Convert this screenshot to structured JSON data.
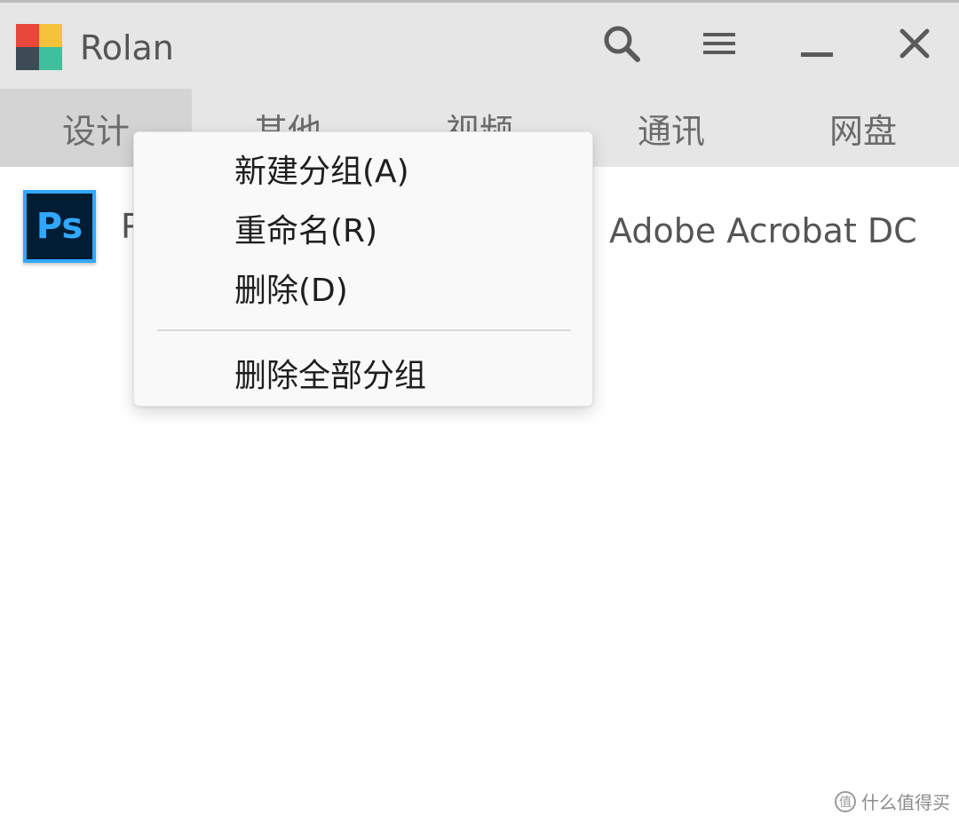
{
  "window": {
    "title": "Rolan",
    "logo_colors": [
      "#e8473c",
      "#f5c33b",
      "#3e4a56",
      "#3fbf9b"
    ]
  },
  "titlebar_buttons": {
    "search": "search-icon",
    "menu": "hamburger-menu-icon",
    "minimize": "minimize-icon",
    "close": "close-icon"
  },
  "tabs": [
    {
      "label": "设计",
      "active": true
    },
    {
      "label": "其他",
      "active": false
    },
    {
      "label": "视频",
      "active": false
    },
    {
      "label": "通讯",
      "active": false
    },
    {
      "label": "网盘",
      "active": false
    }
  ],
  "apps": [
    {
      "icon_text": "Ps",
      "label": "P",
      "icon_color": "#31a8ff",
      "icon_bg": "#001d34"
    },
    {
      "label": "Adobe Acrobat DC"
    }
  ],
  "context_menu": {
    "items": [
      {
        "label": "新建分组(A)"
      },
      {
        "label": "重命名(R)"
      },
      {
        "label": "删除(D)"
      },
      {
        "label": "删除全部分组"
      }
    ]
  },
  "watermark": {
    "glyph": "值",
    "text": "什么值得买"
  }
}
